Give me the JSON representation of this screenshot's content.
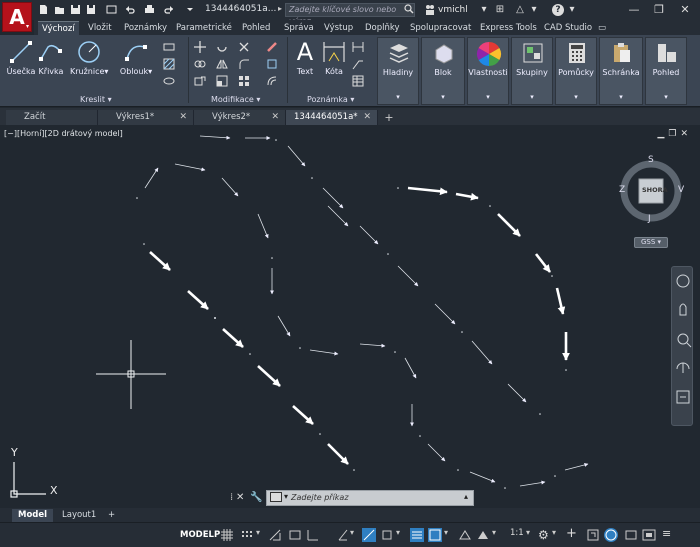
{
  "window": {
    "doc_title": "1344464051a...",
    "search_placeholder": "Zadejte klíčové slovo nebo výraz.",
    "user_name": "vmichl",
    "help_label": "?"
  },
  "ribbon_tabs": [
    {
      "label": "Výchozí",
      "active": true
    },
    {
      "label": "Vložit"
    },
    {
      "label": "Poznámky"
    },
    {
      "label": "Parametrické"
    },
    {
      "label": "Pohled"
    },
    {
      "label": "Správa"
    },
    {
      "label": "Výstup"
    },
    {
      "label": "Doplňky"
    },
    {
      "label": "Spolupracovat"
    },
    {
      "label": "Express Tools"
    },
    {
      "label": "CAD Studio"
    }
  ],
  "ribbon": {
    "draw": {
      "line": "Úsečka",
      "polyline": "Křivka",
      "circle": "Kružnice",
      "arc": "Oblouk",
      "group": "Kreslit"
    },
    "modify": {
      "group": "Modifikace"
    },
    "annotation": {
      "text": "Text",
      "dimension": "Kóta",
      "group": "Poznámka"
    },
    "panels": {
      "layers": "Hladiny",
      "block": "Blok",
      "properties": "Vlastnosti",
      "groups": "Skupiny",
      "utilities": "Pomůcky",
      "clipboard": "Schránka",
      "view": "Pohled"
    }
  },
  "doc_tabs": [
    {
      "label": "Začít"
    },
    {
      "label": "Výkres1*"
    },
    {
      "label": "Výkres2*"
    },
    {
      "label": "1344464051a*",
      "active": true
    }
  ],
  "viewport": {
    "label": "[−][Horní][2D drátový model]",
    "viewcube": {
      "top": "SHORA",
      "north": "S",
      "south": "J",
      "east": "V",
      "west": "Z"
    },
    "ucs": "GSS",
    "axis_x": "X",
    "axis_y": "Y"
  },
  "command_line": {
    "placeholder": "Zadejte příkaz"
  },
  "layout_tabs": [
    {
      "label": "Model",
      "active": true
    },
    {
      "label": "Layout1"
    }
  ],
  "status_bar": {
    "model": "MODELP",
    "scale": "1:1"
  },
  "colors": {
    "accent": "#b5121b",
    "background": "#212830",
    "ribbon": "#3b4553"
  }
}
